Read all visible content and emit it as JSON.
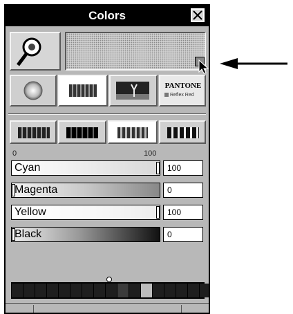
{
  "window": {
    "title": "Colors"
  },
  "scale": {
    "min_label": "0",
    "max_label": "100"
  },
  "sliders": [
    {
      "name": "cyan",
      "label": "Cyan",
      "value": "100",
      "level": 1.0
    },
    {
      "name": "magenta",
      "label": "Magenta",
      "value": "0",
      "level": 0.0
    },
    {
      "name": "yellow",
      "label": "Yellow",
      "value": "100",
      "level": 1.0
    },
    {
      "name": "black",
      "label": "Black",
      "value": "0",
      "level": 0.0
    }
  ],
  "mode_buttons": {
    "pantone_title": "PANTONE",
    "pantone_sub": "Reflex Red"
  },
  "swatches": {
    "count": 17,
    "selected_index": 11
  },
  "icons": {
    "picker": "magnifier-picker-icon",
    "close": "close-icon",
    "wheel": "color-wheel-icon",
    "image": "image-icon",
    "arrow": "arrow-left-icon"
  }
}
